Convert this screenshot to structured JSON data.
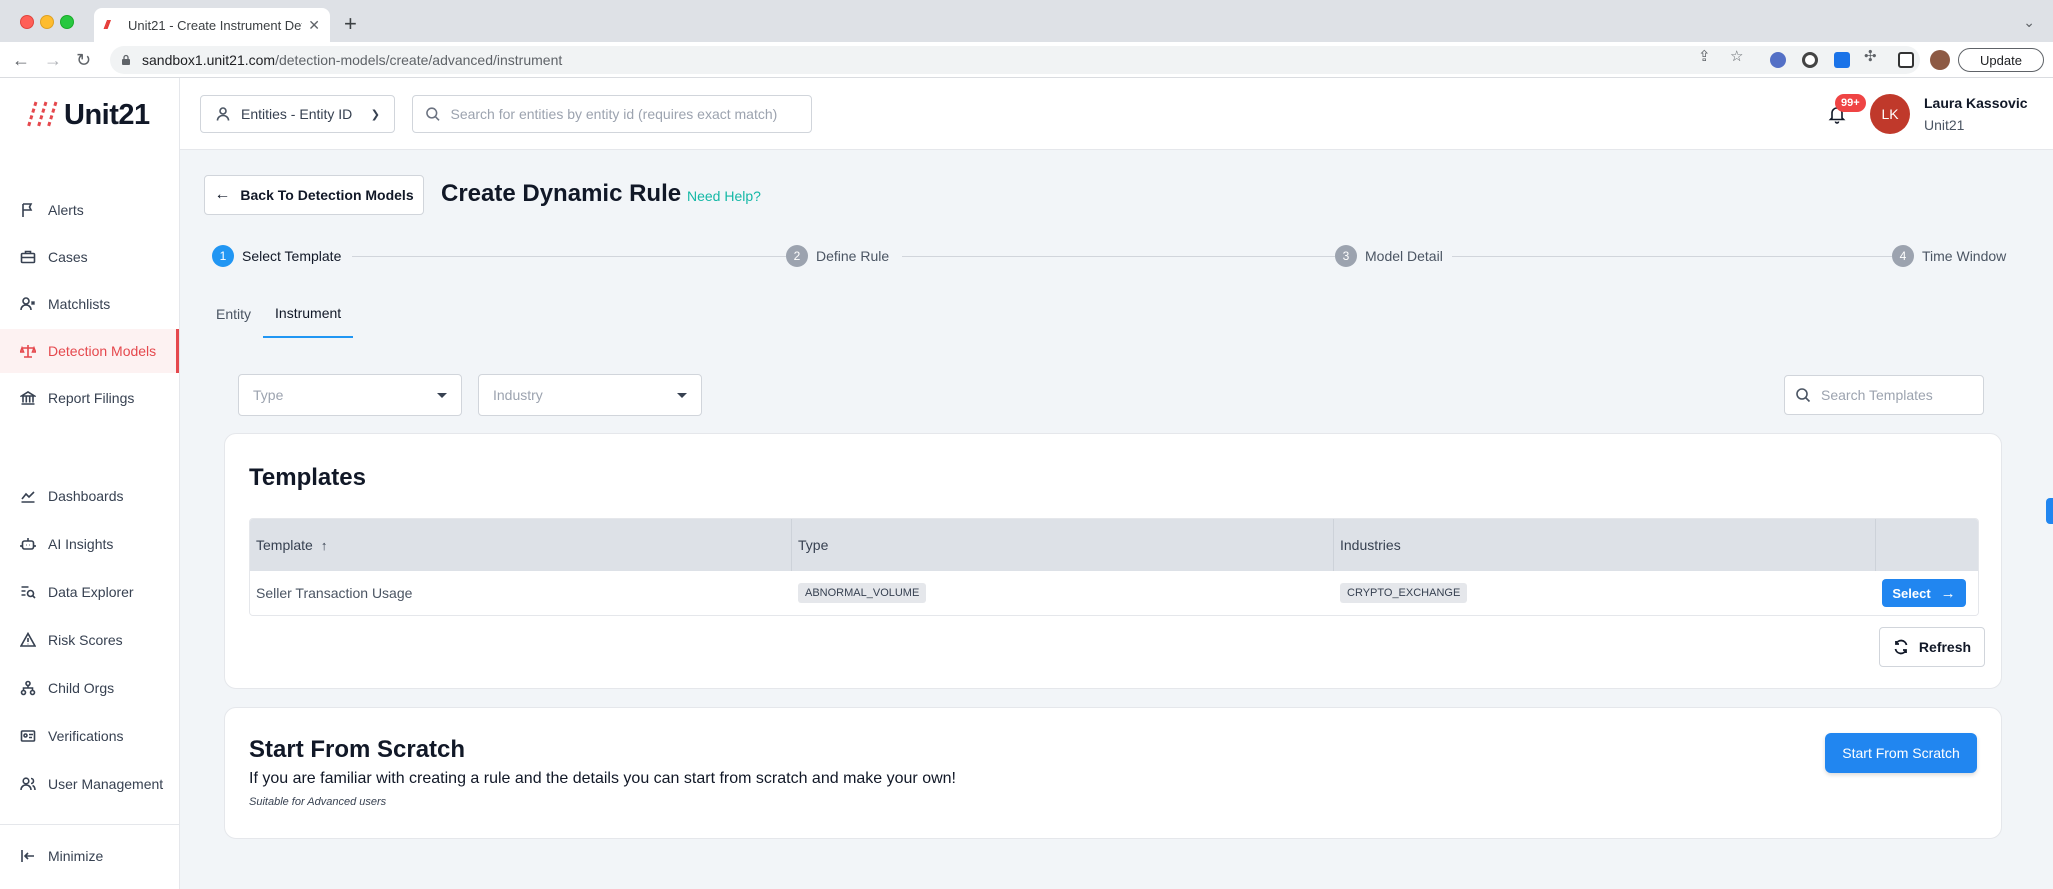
{
  "browser": {
    "tab_title": "Unit21 - Create Instrument Det",
    "url_host": "sandbox1.unit21.com",
    "url_path": "/detection-models/create/advanced/instrument",
    "update_label": "Update"
  },
  "app": {
    "logo_text": "Unit21",
    "entity_select_label": "Entities - Entity ID",
    "entity_search_placeholder": "Search for entities by entity id (requires exact match)",
    "notification_badge": "99+",
    "user": {
      "initials": "LK",
      "name": "Laura Kassovic",
      "org": "Unit21"
    }
  },
  "sidebar": {
    "items": [
      {
        "label": "Alerts",
        "icon": "flag-icon"
      },
      {
        "label": "Cases",
        "icon": "briefcase-icon"
      },
      {
        "label": "Matchlists",
        "icon": "user-x-icon"
      },
      {
        "label": "Detection Models",
        "icon": "scale-icon",
        "active": true
      },
      {
        "label": "Report Filings",
        "icon": "bank-icon"
      },
      {
        "label": "Dashboards",
        "icon": "chart-line-icon"
      },
      {
        "label": "AI Insights",
        "icon": "robot-icon"
      },
      {
        "label": "Data Explorer",
        "icon": "search-list-icon"
      },
      {
        "label": "Risk Scores",
        "icon": "warning-icon"
      },
      {
        "label": "Child Orgs",
        "icon": "org-tree-icon"
      },
      {
        "label": "Verifications",
        "icon": "id-card-icon"
      },
      {
        "label": "User Management",
        "icon": "users-icon"
      }
    ],
    "minimize_label": "Minimize"
  },
  "page": {
    "back_label": "Back To Detection Models",
    "title": "Create Dynamic Rule",
    "help_label": "Need Help?",
    "steps": [
      {
        "num": "1",
        "label": "Select Template",
        "active": true
      },
      {
        "num": "2",
        "label": "Define Rule"
      },
      {
        "num": "3",
        "label": "Model Detail"
      },
      {
        "num": "4",
        "label": "Time Window"
      }
    ],
    "tabs": [
      {
        "label": "Entity"
      },
      {
        "label": "Instrument",
        "active": true
      }
    ],
    "filters": {
      "type_placeholder": "Type",
      "industry_placeholder": "Industry",
      "search_placeholder": "Search Templates"
    },
    "templates": {
      "title": "Templates",
      "columns": [
        "Template",
        "Type",
        "Industries"
      ],
      "rows": [
        {
          "template": "Seller Transaction Usage",
          "type": "ABNORMAL_VOLUME",
          "industries": "CRYPTO_EXCHANGE",
          "action": "Select"
        }
      ],
      "refresh_label": "Refresh"
    },
    "scratch": {
      "title": "Start From Scratch",
      "description": "If you are familiar with creating a rule and the details you can start from scratch and make your own!",
      "note": "Suitable for Advanced users",
      "button_label": "Start From Scratch"
    }
  },
  "colors": {
    "brand_red": "#e5484d",
    "primary_blue": "#2186f0",
    "help_teal": "#14b8a6"
  }
}
